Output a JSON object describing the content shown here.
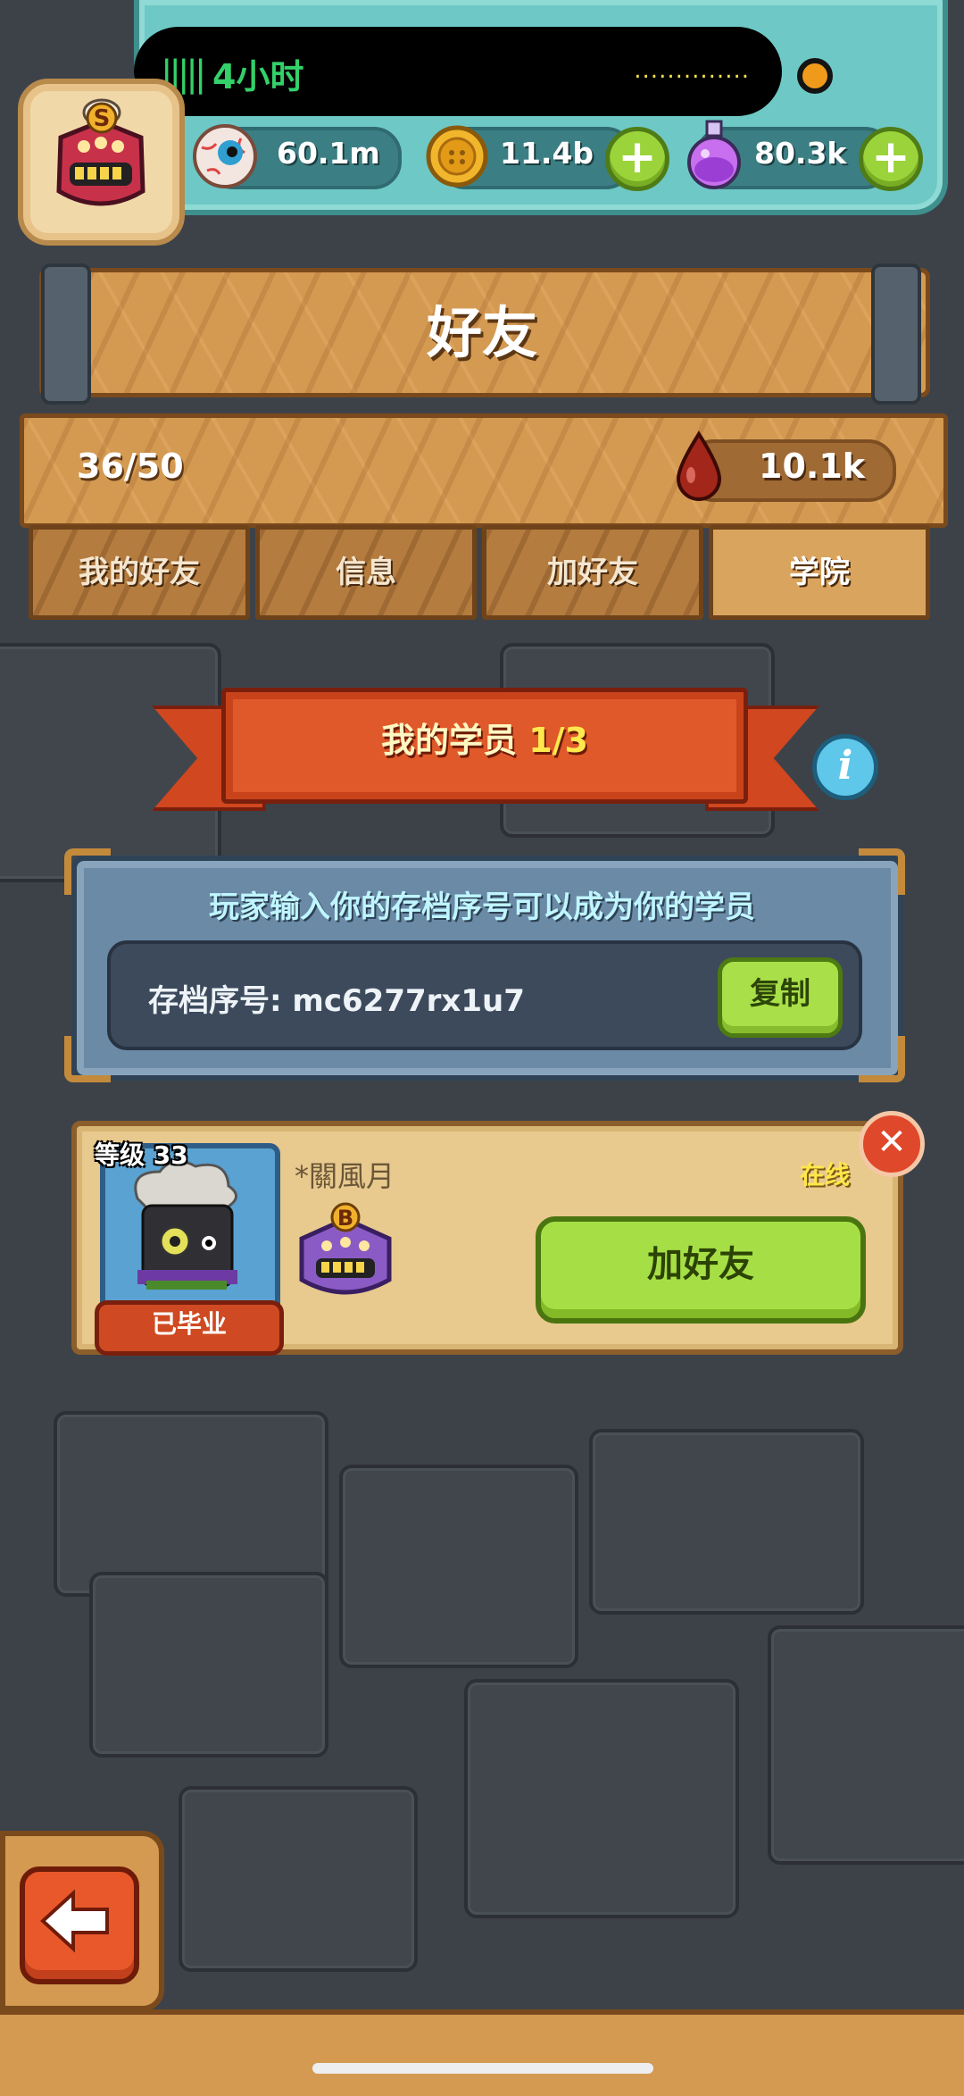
{
  "status_bar": {
    "activity_time": "4小时"
  },
  "resources": [
    {
      "icon": "eyeball-icon",
      "value": "60.1m"
    },
    {
      "icon": "gold-coin-icon",
      "value": "11.4b"
    },
    {
      "icon": "potion-icon",
      "value": "80.3k"
    }
  ],
  "player": {
    "rank_letter": "S"
  },
  "header": {
    "title": "好友"
  },
  "friends": {
    "count": "36/50",
    "blood_value": "10.1k"
  },
  "tabs": [
    {
      "label": "我的好友",
      "active": false
    },
    {
      "label": "信息",
      "active": false
    },
    {
      "label": "加好友",
      "active": false
    },
    {
      "label": "学院",
      "active": true
    }
  ],
  "students": {
    "banner_label": "我的学员",
    "banner_count": "1/3",
    "invite_heading": "玩家输入你的存档序号可以成为你的学员",
    "serial_label": "存档序号: mc6277rx1u7",
    "copy_label": "复制"
  },
  "student_card": {
    "level_label": "等级 33",
    "name": "*關風月",
    "status": "在线",
    "graduated_label": "已毕业",
    "rank_letter": "B",
    "add_friend_label": "加好友"
  },
  "colors": {
    "accent_green": "#a6df45",
    "teal_bar": "#6ec9c6",
    "wood": "#d49a52",
    "ribbon": "#e0592a"
  }
}
